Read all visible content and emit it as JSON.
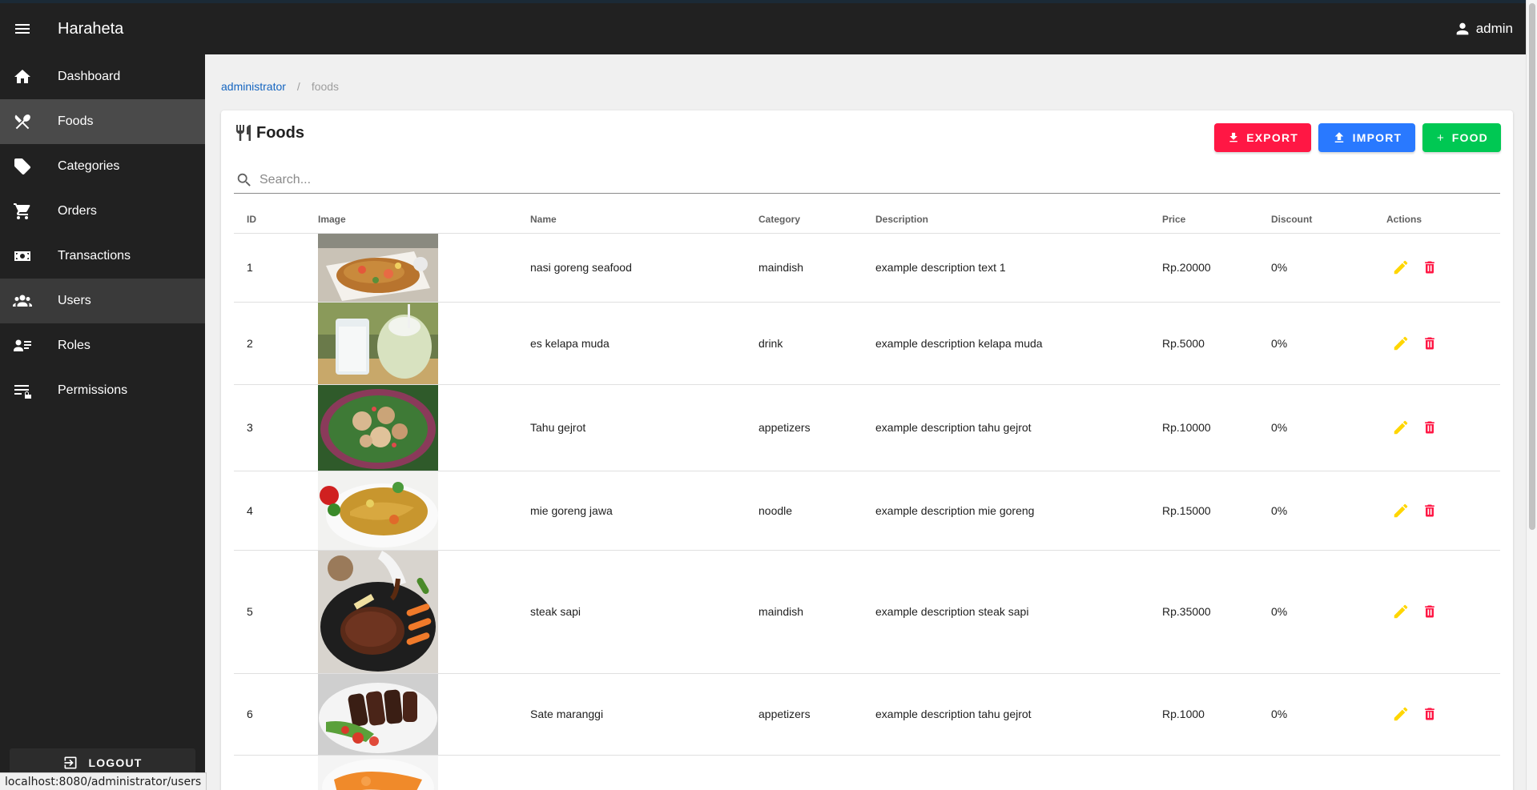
{
  "app": {
    "title": "Haraheta",
    "user": "admin"
  },
  "sidebar": {
    "items": [
      {
        "label": "Dashboard",
        "icon": "home-icon"
      },
      {
        "label": "Foods",
        "icon": "silverware-icon"
      },
      {
        "label": "Categories",
        "icon": "tags-icon"
      },
      {
        "label": "Orders",
        "icon": "cart-icon"
      },
      {
        "label": "Transactions",
        "icon": "cash-icon"
      },
      {
        "label": "Users",
        "icon": "users-icon"
      },
      {
        "label": "Roles",
        "icon": "roles-icon"
      },
      {
        "label": "Permissions",
        "icon": "permissions-icon"
      }
    ],
    "logout_label": "LOGOUT"
  },
  "status_url": "localhost:8080/administrator/users",
  "breadcrumb": {
    "root": "administrator",
    "separator": "/",
    "current": "foods"
  },
  "page": {
    "title": "Foods",
    "buttons": {
      "export": "EXPORT",
      "import": "IMPORT",
      "add": "FOOD"
    },
    "search_placeholder": "Search..."
  },
  "colors": {
    "export": "#ff1744",
    "import": "#2979ff",
    "add": "#00c853",
    "edit_icon": "#ffd600",
    "delete_icon": "#ff1744",
    "link": "#1565c0"
  },
  "table": {
    "columns": [
      "ID",
      "Image",
      "Name",
      "Category",
      "Description",
      "Price",
      "Discount",
      "Actions"
    ],
    "rows": [
      {
        "id": "1",
        "name": "nasi goreng seafood",
        "category": "maindish",
        "description": "example description text 1",
        "price": "Rp.20000",
        "discount": "0%"
      },
      {
        "id": "2",
        "name": "es kelapa muda",
        "category": "drink",
        "description": "example description kelapa muda",
        "price": "Rp.5000",
        "discount": "0%"
      },
      {
        "id": "3",
        "name": "Tahu gejrot",
        "category": "appetizers",
        "description": "example description tahu gejrot",
        "price": "Rp.10000",
        "discount": "0%"
      },
      {
        "id": "4",
        "name": "mie goreng jawa",
        "category": "noodle",
        "description": "example description mie goreng",
        "price": "Rp.15000",
        "discount": "0%"
      },
      {
        "id": "5",
        "name": "steak sapi",
        "category": "maindish",
        "description": "example description steak sapi",
        "price": "Rp.35000",
        "discount": "0%"
      },
      {
        "id": "6",
        "name": "Sate maranggi",
        "category": "appetizers",
        "description": "example description tahu gejrot",
        "price": "Rp.1000",
        "discount": "0%"
      }
    ]
  }
}
